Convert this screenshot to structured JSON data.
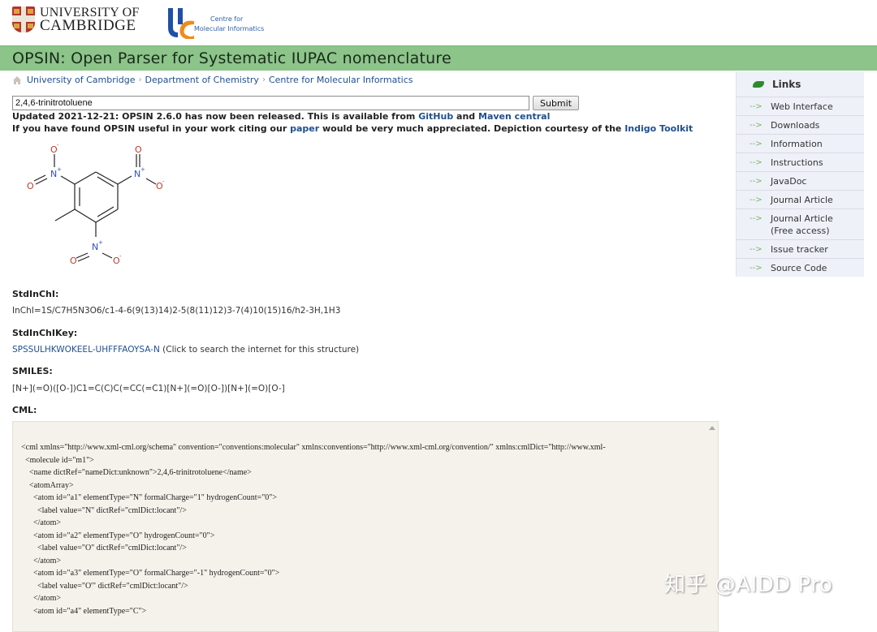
{
  "header": {
    "university_line1": "UNIVERSITY OF",
    "university_line2": "CAMBRIDGE",
    "cmi_line1": "Centre for",
    "cmi_line2": "Molecular Informatics"
  },
  "page_title": "OPSIN: Open Parser for Systematic IUPAC nomenclature",
  "breadcrumb": [
    {
      "label": "University of Cambridge"
    },
    {
      "label": "Department of Chemistry"
    },
    {
      "label": "Centre for Molecular Informatics"
    }
  ],
  "breadcrumb_separator": "›",
  "search": {
    "value": "2,4,6-trinitrotoluene",
    "submit_label": "Submit"
  },
  "notices": {
    "update_prefix": "Updated 2021-12-21: OPSIN 2.6.0 has now been released. This is available from ",
    "github_link": "GitHub",
    "and_text": " and ",
    "maven_link": "Maven central",
    "cite_prefix": "If you have found OPSIN useful in your work citing our ",
    "paper_link": "paper",
    "cite_middle": " would be very much appreciated. Depiction courtesy of the ",
    "indigo_link": "Indigo Toolkit"
  },
  "molecule_labels": {
    "oxygen": "O",
    "nitrogen": "N",
    "plus": "+",
    "minus": "-"
  },
  "results": {
    "inchi_label": "StdInChI:",
    "inchi_value": "InChI=1S/C7H5N3O6/c1-4-6(9(13)14)2-5(8(11)12)3-7(4)10(15)16/h2-3H,1H3",
    "inchikey_label": "StdInChIKey:",
    "inchikey_value": "SPSSULHKWOKEEL-UHFFFAOYSA-N",
    "inchikey_note": " (Click to search the internet for this structure)",
    "smiles_label": "SMILES:",
    "smiles_value": "[N+](=O)([O-])C1=C(C)C(=CC(=C1)[N+](=O)[O-])[N+](=O)[O-]",
    "cml_label": "CML:",
    "cml_lines": [
      "<cml xmlns=\"http://www.xml-cml.org/schema\" convention=\"conventions:molecular\" xmlns:conventions=\"http://www.xml-cml.org/convention/\" xmlns:cmlDict=\"http://www.xml-",
      "  <molecule id=\"m1\">",
      "    <name dictRef=\"nameDict:unknown\">2,4,6-trinitrotoluene</name>",
      "    <atomArray>",
      "      <atom id=\"a1\" elementType=\"N\" formalCharge=\"1\" hydrogenCount=\"0\">",
      "        <label value=\"N\" dictRef=\"cmlDict:locant\"/>",
      "      </atom>",
      "      <atom id=\"a2\" elementType=\"O\" hydrogenCount=\"0\">",
      "        <label value=\"O\" dictRef=\"cmlDict:locant\"/>",
      "      </atom>",
      "      <atom id=\"a3\" elementType=\"O\" formalCharge=\"-1\" hydrogenCount=\"0\">",
      "        <label value=\"O'\" dictRef=\"cmlDict:locant\"/>",
      "      </atom>",
      "      <atom id=\"a4\" elementType=\"C\">"
    ]
  },
  "sidebar": {
    "title": "Links",
    "items": [
      {
        "label": "Web Interface"
      },
      {
        "label": "Downloads"
      },
      {
        "label": "Information"
      },
      {
        "label": "Instructions"
      },
      {
        "label": "JavaDoc"
      },
      {
        "label": "Journal Article"
      },
      {
        "label": "Journal Article (Free access)"
      },
      {
        "label": "Issue tracker"
      },
      {
        "label": "Source Code"
      }
    ],
    "arrow": "-->"
  },
  "watermark": "知乎 @AIDD Pro",
  "colors": {
    "banner": "#8cc48a",
    "link": "#1f4f8f",
    "sidebar_bg": "#eef1f8",
    "cml_bg": "#f5f2eb",
    "oxygen": "#c0392b",
    "nitrogen": "#3050c0"
  }
}
